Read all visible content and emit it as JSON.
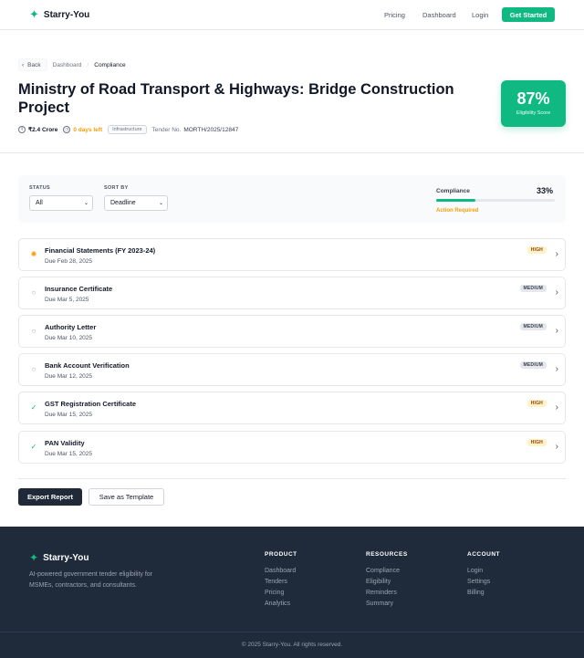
{
  "brand": {
    "name": "Starry-You",
    "icon": "sparkle-icon",
    "accent": "#10b981"
  },
  "nav": {
    "links": [
      "Pricing",
      "Dashboard",
      "Login"
    ],
    "cta": "Get Started"
  },
  "breadcrumb": {
    "back": "Back",
    "items": [
      "Dashboard",
      "Compliance"
    ]
  },
  "project": {
    "title": "Ministry of Road Transport & Highways: Bridge Construction Project",
    "value": "₹2.4 Crore",
    "days_left": "0 days left",
    "category": "Infrastructure",
    "tender_label": "Tender No.",
    "tender_no": "MORTH/2025/12847"
  },
  "score": {
    "value": "87%",
    "label": "Eligibility Score"
  },
  "filters": {
    "status_label": "STATUS",
    "status_value": "All",
    "sort_label": "SORT BY",
    "sort_value": "Deadline"
  },
  "compliance": {
    "label": "Compliance",
    "value": "33%",
    "fraction": 0.33,
    "status": "Action Required"
  },
  "documents": [
    {
      "name": "Financial Statements (FY 2023-24)",
      "due": "Due Feb 28, 2025",
      "priority": "HIGH",
      "status": "in-progress"
    },
    {
      "name": "Insurance Certificate",
      "due": "Due Mar 5, 2025",
      "priority": "MEDIUM",
      "status": "pending"
    },
    {
      "name": "Authority Letter",
      "due": "Due Mar 10, 2025",
      "priority": "MEDIUM",
      "status": "pending"
    },
    {
      "name": "Bank Account Verification",
      "due": "Due Mar 12, 2025",
      "priority": "MEDIUM",
      "status": "pending"
    },
    {
      "name": "GST Registration Certificate",
      "due": "Due Mar 15, 2025",
      "priority": "HIGH",
      "status": "complete"
    },
    {
      "name": "PAN Validity",
      "due": "Due Mar 15, 2025",
      "priority": "HIGH",
      "status": "complete"
    }
  ],
  "actions": {
    "export": "Export Report",
    "template": "Save as Template"
  },
  "footer": {
    "tagline": "AI-powered government tender eligibility for MSMEs, contractors, and consultants.",
    "columns": [
      {
        "heading": "PRODUCT",
        "links": [
          "Dashboard",
          "Tenders",
          "Pricing",
          "Analytics"
        ]
      },
      {
        "heading": "RESOURCES",
        "links": [
          "Compliance",
          "Eligibility",
          "Reminders",
          "Summary"
        ]
      },
      {
        "heading": "ACCOUNT",
        "links": [
          "Login",
          "Settings",
          "Billing"
        ]
      }
    ],
    "copyright": "© 2025 Starry-You. All rights reserved."
  }
}
